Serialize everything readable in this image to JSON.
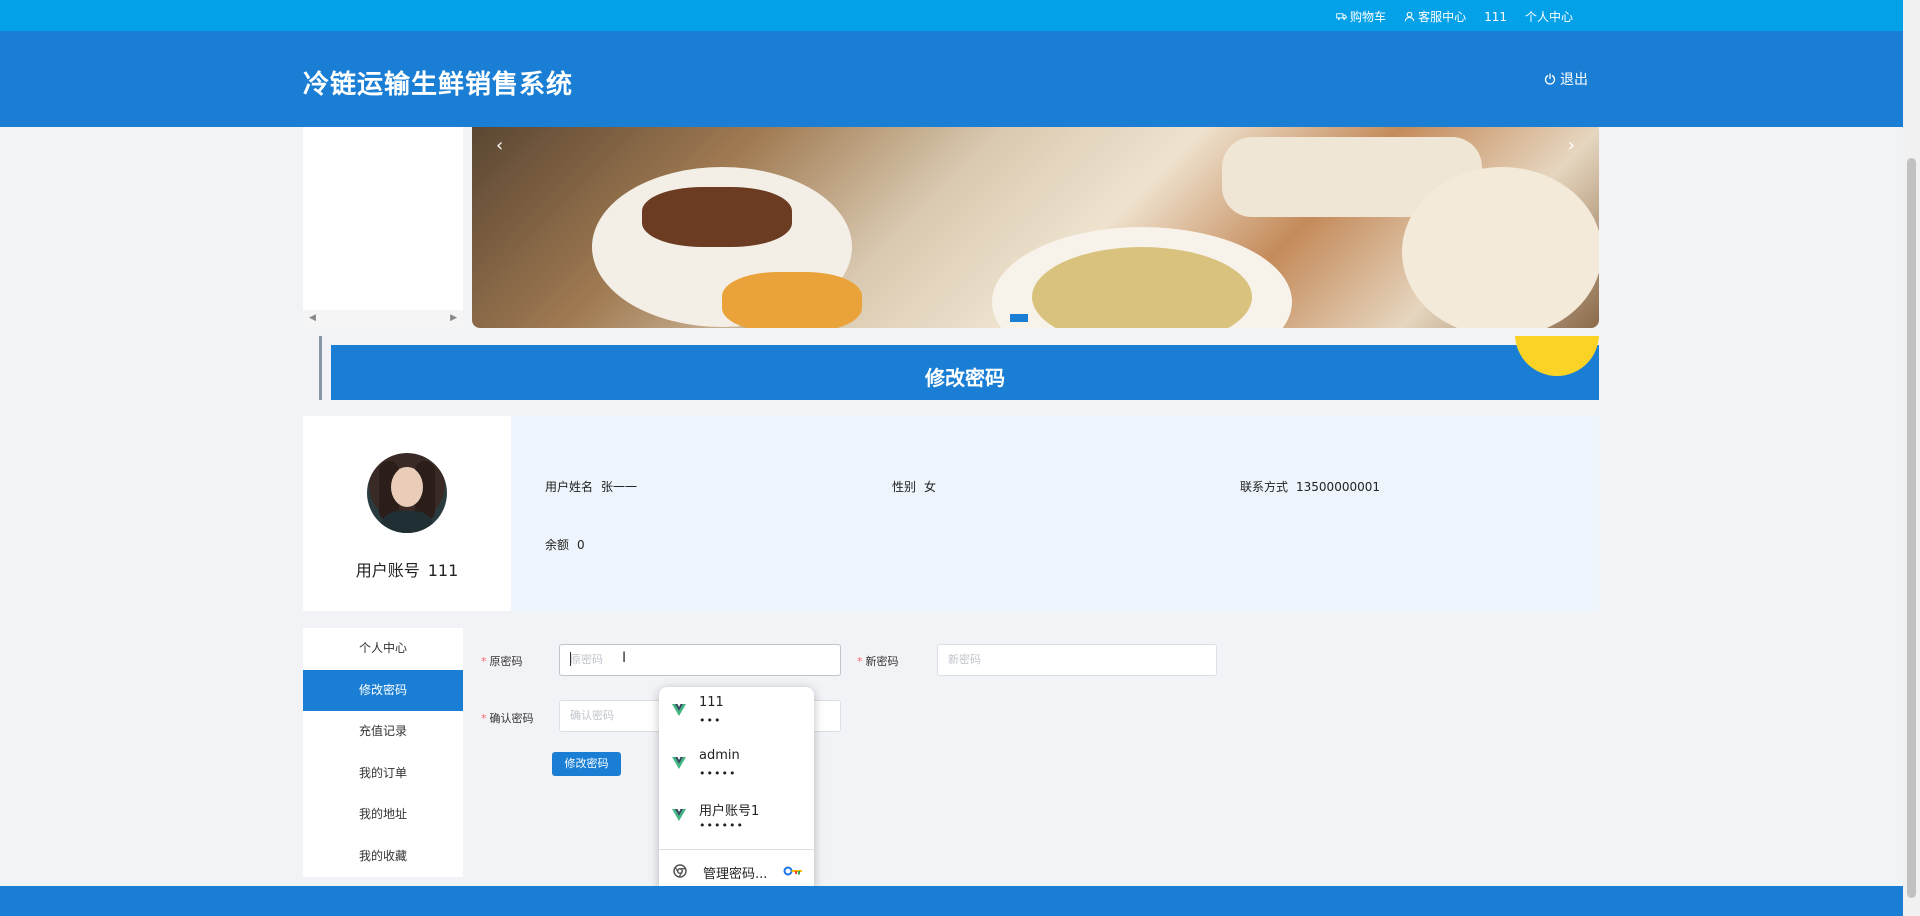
{
  "topbar": {
    "cart": "购物车",
    "service": "客服中心",
    "username": "111",
    "personal": "个人中心"
  },
  "header": {
    "site_title": "冷链运输生鲜销售系统",
    "logout": "退出"
  },
  "carousel": {
    "prev": "‹",
    "next": "›"
  },
  "section": {
    "title": "修改密码"
  },
  "user": {
    "account_label": "用户账号",
    "account_value": "111",
    "name_label": "用户姓名",
    "name_value": "张一一",
    "gender_label": "性别",
    "gender_value": "女",
    "contact_label": "联系方式",
    "contact_value": "13500000001",
    "balance_label": "余额",
    "balance_value": "0"
  },
  "menu": {
    "items": [
      "个人中心",
      "修改密码",
      "充值记录",
      "我的订单",
      "我的地址",
      "我的收藏"
    ],
    "active": "修改密码"
  },
  "form": {
    "old_password_label": "原密码",
    "old_password_placeholder": "原密码",
    "new_password_label": "新密码",
    "new_password_placeholder": "新密码",
    "confirm_password_label": "确认密码",
    "confirm_password_placeholder": "确认密码",
    "submit": "修改密码"
  },
  "autocomplete": {
    "credentials": [
      {
        "user": "111",
        "password_mask": "•••"
      },
      {
        "user": "admin",
        "password_mask": "•••••"
      },
      {
        "user": "用户账号1",
        "password_mask": "••••••"
      }
    ],
    "manage": "管理密码..."
  },
  "colors": {
    "topbar": "#03a2e8",
    "header": "#1a7fd4",
    "accent_yellow": "#fbd326",
    "info_panel": "#eef4fb"
  }
}
